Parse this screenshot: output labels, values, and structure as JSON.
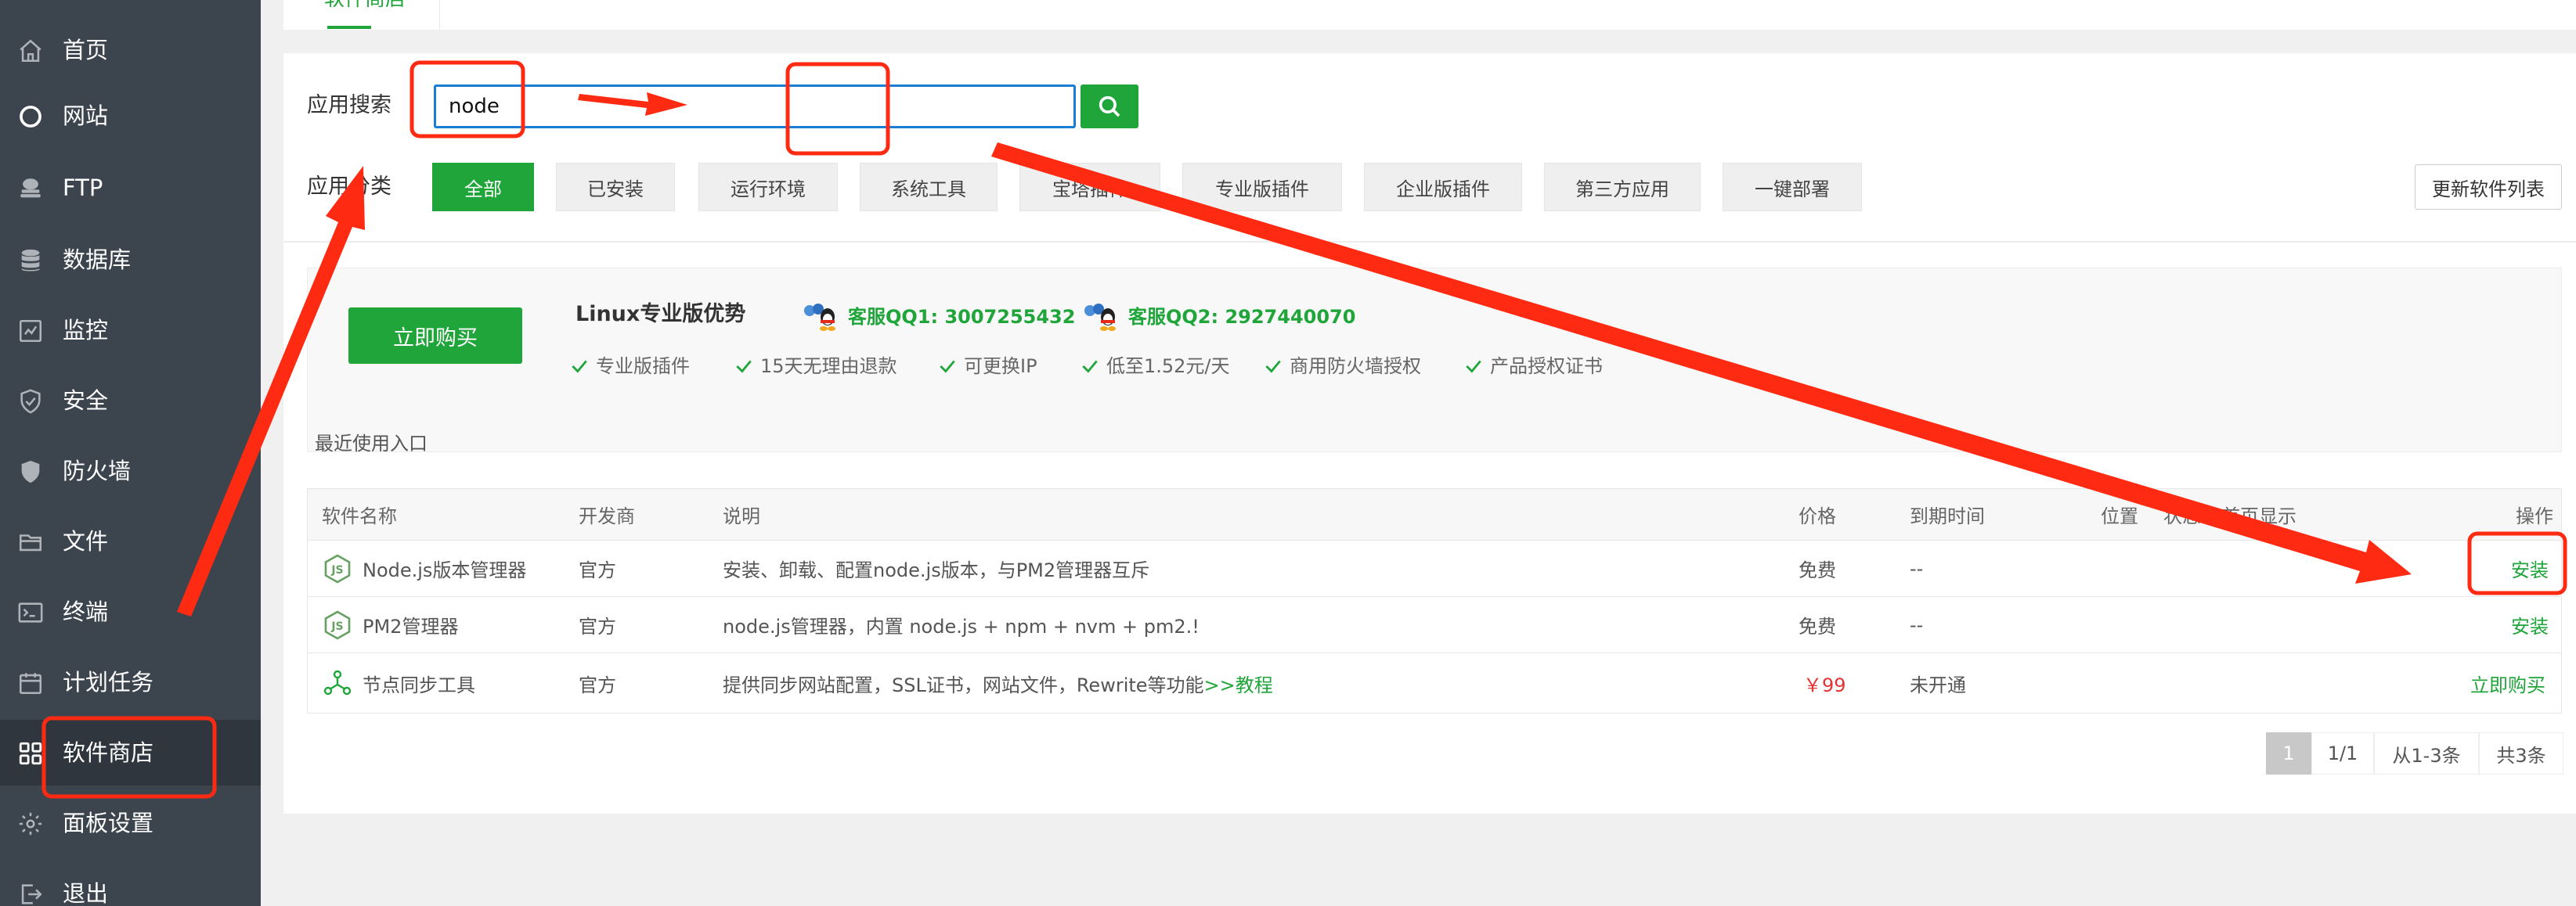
{
  "sidebar": {
    "items": [
      {
        "label": "首页",
        "icon": "home-icon"
      },
      {
        "label": "网站",
        "icon": "globe-icon"
      },
      {
        "label": "FTP",
        "icon": "ftp-icon"
      },
      {
        "label": "数据库",
        "icon": "database-icon"
      },
      {
        "label": "监控",
        "icon": "monitor-icon"
      },
      {
        "label": "安全",
        "icon": "shield-icon"
      },
      {
        "label": "防火墙",
        "icon": "firewall-icon"
      },
      {
        "label": "文件",
        "icon": "folder-icon"
      },
      {
        "label": "终端",
        "icon": "terminal-icon"
      },
      {
        "label": "计划任务",
        "icon": "calendar-icon"
      },
      {
        "label": "软件商店",
        "icon": "app-grid-icon",
        "active": true
      },
      {
        "label": "面板设置",
        "icon": "gear-icon"
      },
      {
        "label": "退出",
        "icon": "logout-icon"
      }
    ]
  },
  "top_tab": {
    "label": "软件商店"
  },
  "search": {
    "label": "应用搜索",
    "value": "node"
  },
  "category": {
    "label": "应用分类",
    "items": [
      "全部",
      "已安装",
      "运行环境",
      "系统工具",
      "宝塔插件",
      "专业版插件",
      "企业版插件",
      "第三方应用",
      "一键部署"
    ],
    "active_index": 0
  },
  "update_button": "更新软件列表",
  "promo": {
    "buy_label": "立即购买",
    "title": "Linux专业版优势",
    "qq1": "客服QQ1: 3007255432",
    "qq2": "客服QQ2: 2927440070",
    "perks": [
      "专业版插件",
      "15天无理由退款",
      "可更换IP",
      "低至1.52元/天",
      "商用防火墙授权",
      "产品授权证书"
    ]
  },
  "recent_label": "最近使用入口",
  "table": {
    "headers": {
      "name": "软件名称",
      "developer": "开发商",
      "description": "说明",
      "price": "价格",
      "expire": "到期时间",
      "position": "位置",
      "status": "状态",
      "homepage": "首页显示",
      "action": "操作"
    },
    "rows": [
      {
        "name": "Node.js版本管理器",
        "icon": "nodejs-icon",
        "developer": "官方",
        "description": "安装、卸载、配置node.js版本，与PM2管理器互斥",
        "description_link": "",
        "price": "免费",
        "expire": "--",
        "action": "安装"
      },
      {
        "name": "PM2管理器",
        "icon": "nodejs-icon",
        "developer": "官方",
        "description": "node.js管理器，内置 node.js + npm + nvm + pm2.!",
        "description_link": "",
        "price": "免费",
        "expire": "--",
        "action": "安装"
      },
      {
        "name": "节点同步工具",
        "icon": "node-sync-icon",
        "developer": "官方",
        "description": "提供同步网站配置，SSL证书，网站文件，Rewrite等功能",
        "description_link": ">>教程",
        "price": "￥99",
        "expire": "未开通",
        "action": "立即购买"
      }
    ]
  },
  "pagination": {
    "current": "1",
    "pages": "1/1",
    "range": "从1-3条",
    "total": "共3条"
  },
  "colors": {
    "accent": "#20a53a",
    "sidebar_bg": "#3c444d",
    "annotation": "#ff2a12",
    "price_red": "#e53333",
    "search_border": "#1a7fd4"
  }
}
